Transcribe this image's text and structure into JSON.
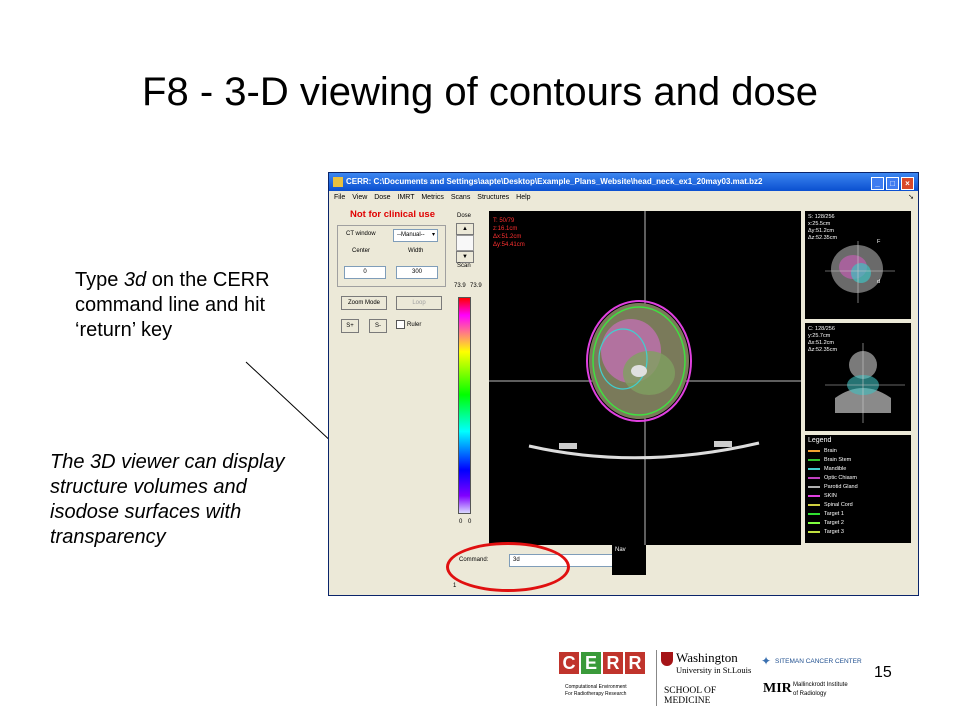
{
  "slide": {
    "title": "F8 - 3-D viewing of contours and dose",
    "note1_prefix": "Type ",
    "note1_italic": "3d",
    "note1_rest": " on the CERR command line and hit ‘return’ key",
    "note2": "The 3D viewer can display structure volumes and isodose surfaces with transparency",
    "page_number": "15"
  },
  "window": {
    "title": "CERR:  C:\\Documents and Settings\\aapte\\Desktop\\Example_Plans_Website\\head_neck_ex1_20may03.mat.bz2",
    "menu": [
      "File",
      "View",
      "Dose",
      "IMRT",
      "Metrics",
      "Scans",
      "Structures",
      "Help"
    ],
    "min_glyph": "_",
    "max_glyph": "□",
    "close_glyph": "×"
  },
  "left_panel": {
    "warning": "Not for clinical use",
    "ct_window_label": "CT window",
    "ct_window_value": "--Manual--",
    "center_label": "Center",
    "width_label": "Width",
    "center_value": "0",
    "width_value": "300",
    "zoom_mode": "Zoom Mode",
    "loop": "Loop",
    "splus": "S+",
    "sminus": "S-",
    "ruler": "Ruler"
  },
  "dose_controls": {
    "dose_label": "Dose",
    "scan_label": "Scan",
    "max_left": "73.9",
    "max_right": "73.9",
    "min_left": "0",
    "min_right": "0"
  },
  "main_view": {
    "lines": [
      "T: 50/79",
      "z:16.1cm",
      "Δx:51.2cm",
      "Δy:54.41cm"
    ]
  },
  "sagittal_view": {
    "lines": [
      "S: 128/256",
      "x:25.5cm",
      "Δy:51.2cm",
      "Δz:52.35cm"
    ],
    "marker_f": "F",
    "marker_d": "d"
  },
  "coronal_view": {
    "lines": [
      "C: 128/256",
      "y:25.7cm",
      "Δx:51.2cm",
      "Δz:52.35cm"
    ]
  },
  "legend": {
    "title": "Legend",
    "items": [
      {
        "name": "Brain",
        "color": "#f0a030"
      },
      {
        "name": "Brain Stem",
        "color": "#30c030"
      },
      {
        "name": "Mandible",
        "color": "#40d0d0"
      },
      {
        "name": "Optic Chiasm",
        "color": "#c040c0"
      },
      {
        "name": "Parotid Gland",
        "color": "#b0b0b0"
      },
      {
        "name": "SKIN",
        "color": "#e040e0"
      },
      {
        "name": "Spinal Cord",
        "color": "#d0d040"
      },
      {
        "name": "Target 1",
        "color": "#30e030"
      },
      {
        "name": "Target 2",
        "color": "#80ff40"
      },
      {
        "name": "Target 3",
        "color": "#c0e040"
      }
    ]
  },
  "command": {
    "label": "Command:",
    "value": "3d",
    "nav": "Nav",
    "status_left": "1"
  },
  "logos": {
    "cerr_letters": [
      "C",
      "E",
      "R",
      "R"
    ],
    "cerr_line1": "Computational Environment",
    "cerr_line2": "For Radiotherapy Research",
    "wu_line1": "Washington",
    "wu_line2": "University in St.Louis",
    "wu_line3": "SCHOOL OF MEDICINE",
    "siteman": "SITEMAN CANCER CENTER",
    "mir": "MIR",
    "mir_line1": "Mallinckrodt Institute",
    "mir_line2": "of Radiology"
  }
}
